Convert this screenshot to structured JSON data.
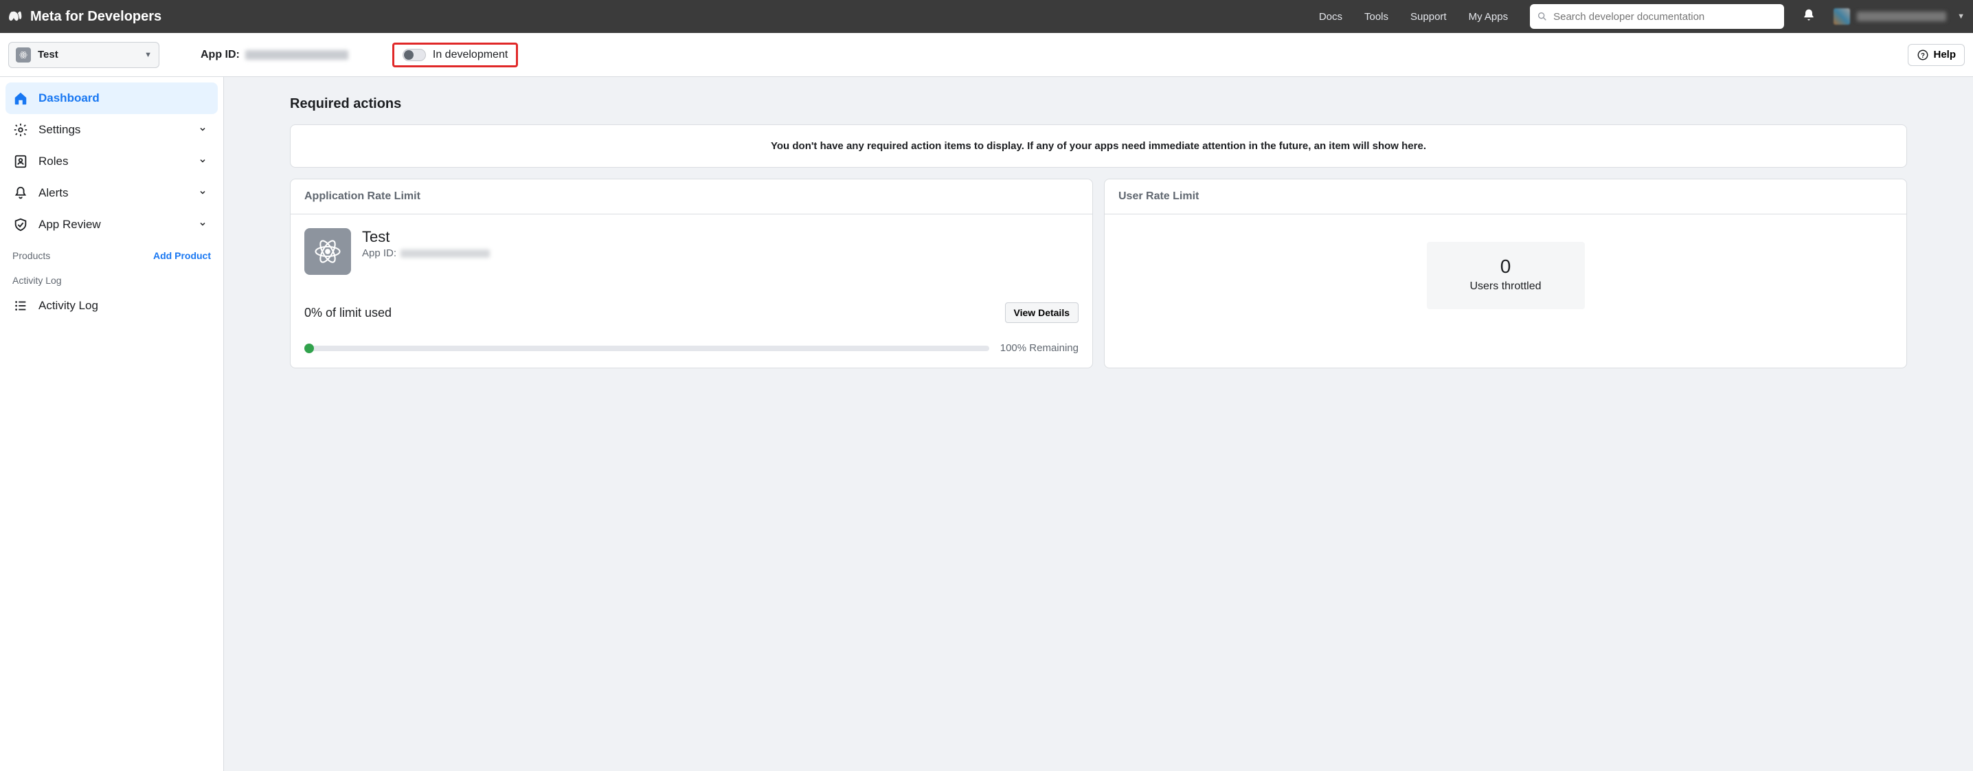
{
  "topnav": {
    "brand": "Meta for Developers",
    "links": [
      "Docs",
      "Tools",
      "Support",
      "My Apps"
    ],
    "search_placeholder": "Search developer documentation"
  },
  "appbar": {
    "selected_app": "Test",
    "app_id_label": "App ID:",
    "dev_status": "In development",
    "help": "Help"
  },
  "sidebar": {
    "items": [
      {
        "icon": "home",
        "label": "Dashboard",
        "active": true,
        "expandable": false
      },
      {
        "icon": "gear",
        "label": "Settings",
        "active": false,
        "expandable": true
      },
      {
        "icon": "roles",
        "label": "Roles",
        "active": false,
        "expandable": true
      },
      {
        "icon": "bell",
        "label": "Alerts",
        "active": false,
        "expandable": true
      },
      {
        "icon": "shield",
        "label": "App Review",
        "active": false,
        "expandable": true
      }
    ],
    "products_header": "Products",
    "add_product": "Add Product",
    "activity_header": "Activity Log",
    "activity_item": "Activity Log"
  },
  "main": {
    "required_title": "Required actions",
    "empty_text": "You don't have any required action items to display. If any of your apps need immediate attention in the future, an item will show here.",
    "card1": {
      "title": "Application Rate Limit",
      "app_name": "Test",
      "app_id_label": "App ID:",
      "limit_used": "0% of limit used",
      "view_details": "View Details",
      "remaining": "100% Remaining"
    },
    "card2": {
      "title": "User Rate Limit",
      "throttled_count": "0",
      "throttled_label": "Users throttled"
    }
  }
}
